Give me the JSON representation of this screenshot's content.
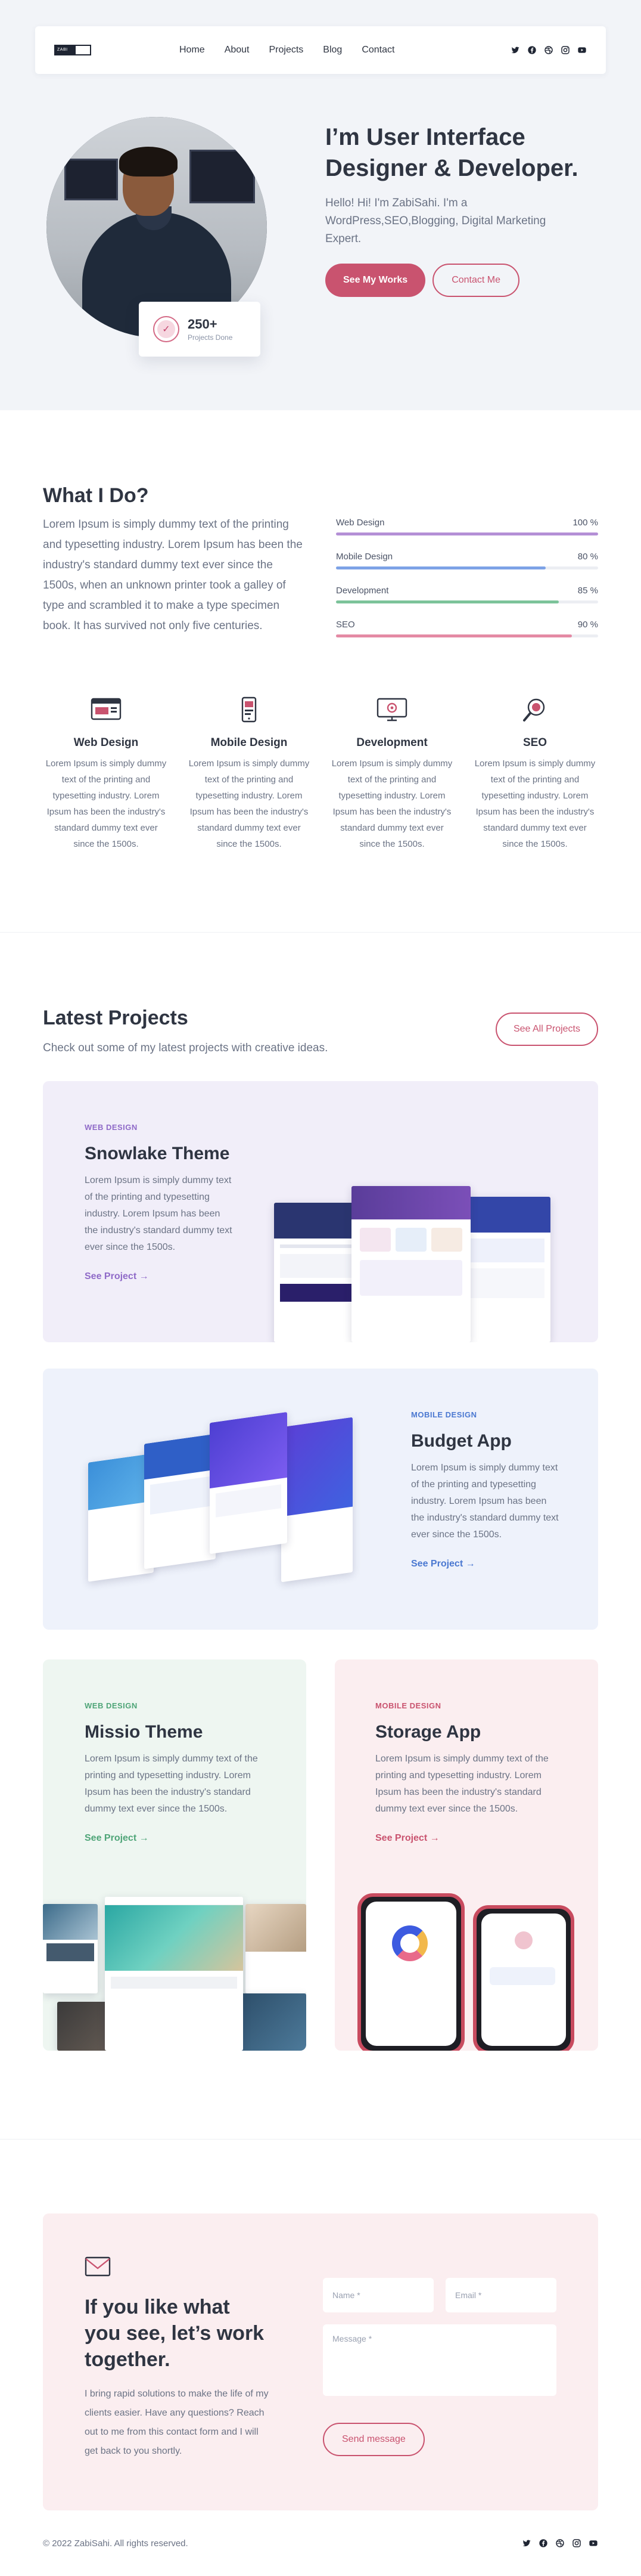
{
  "nav": {
    "logo_text": "ZABI",
    "links": [
      "Home",
      "About",
      "Projects",
      "Blog",
      "Contact"
    ],
    "social": [
      "twitter-icon",
      "facebook-icon",
      "dribbble-icon",
      "instagram-icon",
      "youtube-icon"
    ]
  },
  "hero": {
    "title": "I’m User Interface Designer & Developer.",
    "desc": "Hello! Hi! I'm ZabiSahi. I'm a WordPress,SEO,Blogging, Digital Marketing Expert.",
    "primary_btn": "See My Works",
    "secondary_btn": "Contact Me",
    "badge_num": "250+",
    "badge_label": "Projects Done"
  },
  "whatido": {
    "title": "What I Do?",
    "desc": "Lorem Ipsum is simply dummy text of the printing and typesetting industry. Lorem Ipsum has been the industry's standard dummy text ever since the 1500s, when an unknown printer took a galley of type and scrambled it to make a type specimen book. It has survived not only five centuries.",
    "skills": [
      {
        "name": "Web Design",
        "value": "100 %",
        "pct": 100,
        "color": "#b48fd6"
      },
      {
        "name": "Mobile Design",
        "value": "80 %",
        "pct": 80,
        "color": "#7da2e6"
      },
      {
        "name": "Development",
        "value": "85 %",
        "pct": 85,
        "color": "#7cc39a"
      },
      {
        "name": "SEO",
        "value": "90 %",
        "pct": 90,
        "color": "#e48aa4"
      }
    ],
    "services": [
      {
        "title": "Web Design",
        "desc": "Lorem Ipsum is simply dummy text of the printing and typesetting industry. Lorem Ipsum has been the industry's standard dummy text ever since the 1500s.",
        "icon": "web-design-icon"
      },
      {
        "title": "Mobile Design",
        "desc": "Lorem Ipsum is simply dummy text of the printing and typesetting industry. Lorem Ipsum has been the industry's standard dummy text ever since the 1500s.",
        "icon": "mobile-design-icon"
      },
      {
        "title": "Development",
        "desc": "Lorem Ipsum is simply dummy text of the printing and typesetting industry. Lorem Ipsum has been the industry's standard dummy text ever since the 1500s.",
        "icon": "development-icon"
      },
      {
        "title": "SEO",
        "desc": "Lorem Ipsum is simply dummy text of the printing and typesetting industry. Lorem Ipsum has been the industry's standard dummy text ever since the 1500s.",
        "icon": "seo-icon"
      }
    ]
  },
  "projects": {
    "title": "Latest Projects",
    "subtitle": "Check out some of my latest projects with creative ideas.",
    "all_btn": "See All Projects",
    "items": [
      {
        "tag": "WEB DESIGN",
        "title": "Snowlake Theme",
        "desc": "Lorem Ipsum is simply dummy text of the printing and typesetting industry. Lorem Ipsum has been the industry's standard dummy text ever since the 1500s.",
        "link": "See Project →",
        "bg": "#f1eef9",
        "accent": "#8f6ac8"
      },
      {
        "tag": "MOBILE DESIGN",
        "title": "Budget App",
        "desc": "Lorem Ipsum is simply dummy text of the printing and typesetting industry. Lorem Ipsum has been the industry's standard dummy text ever since the 1500s.",
        "link": "See Project →",
        "bg": "#eef2fb",
        "accent": "#4a78d1"
      },
      {
        "tag": "WEB DESIGN",
        "title": "Missio Theme",
        "desc": "Lorem Ipsum is simply dummy text of the printing and typesetting industry. Lorem Ipsum has been the industry's standard dummy text ever since the 1500s.",
        "link": "See Project →",
        "bg": "#eef6f1",
        "accent": "#4fa578"
      },
      {
        "tag": "MOBILE DESIGN",
        "title": "Storage App",
        "desc": "Lorem Ipsum is simply dummy text of the printing and typesetting industry. Lorem Ipsum has been the industry's standard dummy text ever since the 1500s.",
        "link": "See Project →",
        "bg": "#fbeef0",
        "accent": "#c9536f"
      }
    ]
  },
  "contact": {
    "title": "If you like what you see, let’s work together.",
    "desc": "I bring rapid solutions to make the life of my clients easier. Have any questions? Reach out to me from this contact form and I will get back to you shortly.",
    "name_placeholder": "Name *",
    "email_placeholder": "Email *",
    "message_placeholder": "Message *",
    "send_btn": "Send message"
  },
  "footer": {
    "copyright": "© 2022 ZabiSahi. All rights reserved."
  }
}
